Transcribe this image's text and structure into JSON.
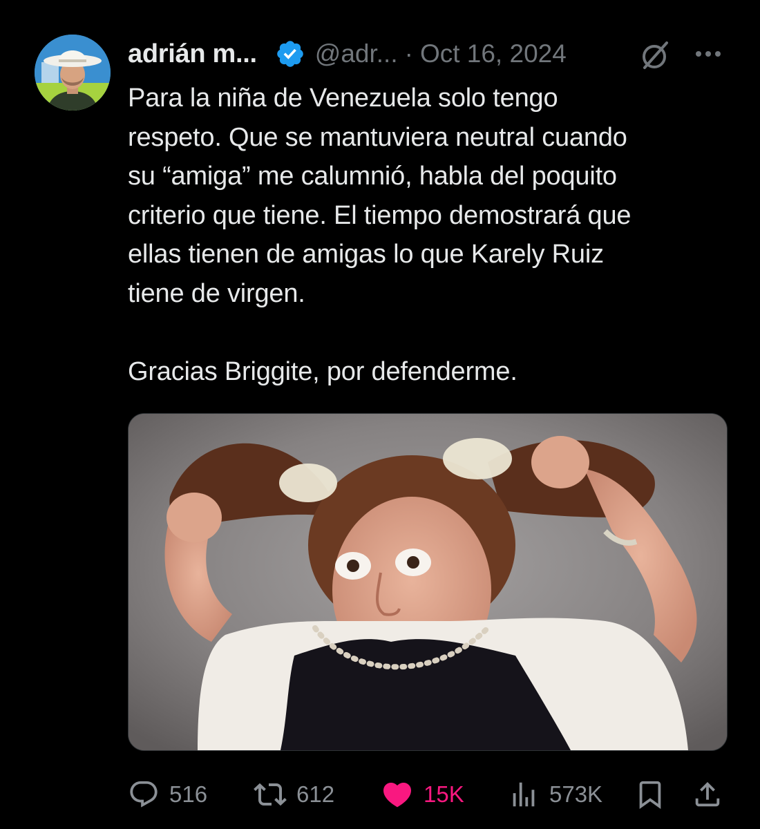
{
  "author": {
    "display_name": "adrián m...",
    "handle": "@adr...",
    "separator": "·",
    "date": "Oct 16, 2024"
  },
  "tweet": {
    "paragraph_1": "Para la niña de Venezuela solo tengo\nrespeto. Que se mantuviera neutral cuando\nsu “amiga” me calumnió, habla del poquito\ncriterio que tiene. El tiempo demostrará que\nellas tienen de amigas lo que Karely Ruiz\ntiene de virgen.",
    "paragraph_2": "Gracias Briggite, por defenderme."
  },
  "actions": {
    "replies": "516",
    "reposts": "612",
    "likes": "15K",
    "views": "573K"
  },
  "icons": {
    "verified": "verified-badge-icon",
    "grok": "grok-icon",
    "more": "more-dots-icon",
    "reply": "reply-icon",
    "repost": "repost-icon",
    "like": "heart-icon",
    "views": "views-icon",
    "bookmark": "bookmark-icon",
    "share": "share-icon"
  },
  "colors": {
    "background": "#000000",
    "text": "#e7e9ea",
    "secondary": "#71767b",
    "verified": "#1d9bf0",
    "like": "#f91880"
  }
}
